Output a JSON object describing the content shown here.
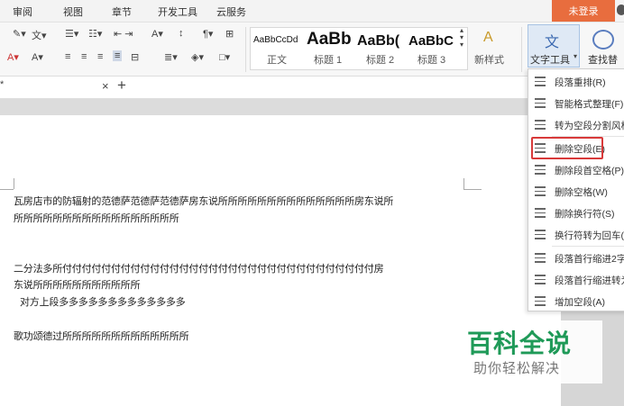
{
  "menu": {
    "items": [
      "审阅",
      "视图",
      "章节",
      "开发工具",
      "云服务"
    ],
    "login": "未登录"
  },
  "ribbon": {
    "styles": [
      {
        "preview": "AaBbCcDd",
        "label": "正文"
      },
      {
        "preview": "AaBb",
        "label": "标题 1"
      },
      {
        "preview": "AaBb(",
        "label": "标题 2"
      },
      {
        "preview": "AaBbC",
        "label": "标题 3"
      }
    ],
    "new_style": "新样式",
    "text_tool": "文字工具",
    "find": "查找替"
  },
  "tabs": {
    "close": "×",
    "add": "+"
  },
  "dropdown": {
    "items": [
      {
        "label": "段落重排(R)"
      },
      {
        "label": "智能格式整理(F)"
      },
      {
        "label": "转为空段分割风格"
      },
      {
        "label": "删除空段(E)"
      },
      {
        "label": "删除段首空格(P)"
      },
      {
        "label": "删除空格(W)"
      },
      {
        "label": "删除换行符(S)"
      },
      {
        "label": "换行符转为回车(L"
      },
      {
        "label": "段落首行缩进2字"
      },
      {
        "label": "段落首行缩进转为"
      },
      {
        "label": "增加空段(A)"
      }
    ],
    "highlighted": "删除空段(E)"
  },
  "document": {
    "lines": [
      "瓦房店市的防辐射的范德萨范德萨范德萨房东说所所所所所所所所所所所所所所房东说所",
      "所所所所所所所所所所所所所所所所所",
      "二分法多所付付付付付付付付付付付付付付付付付付付付付付付付付付付付付付付付房",
      "东说所所所所所所所所所所所",
      "对方上段多多多多多多多多多多多多多",
      "歌功颂德过所所所所所所所所所所所所所"
    ]
  },
  "watermark": {
    "title": "百科全说",
    "subtitle": "助你轻松解决"
  },
  "colors": {
    "accent": "#e86d3e",
    "highlight": "#d83a3a",
    "brand_green": "#1f9a58"
  }
}
